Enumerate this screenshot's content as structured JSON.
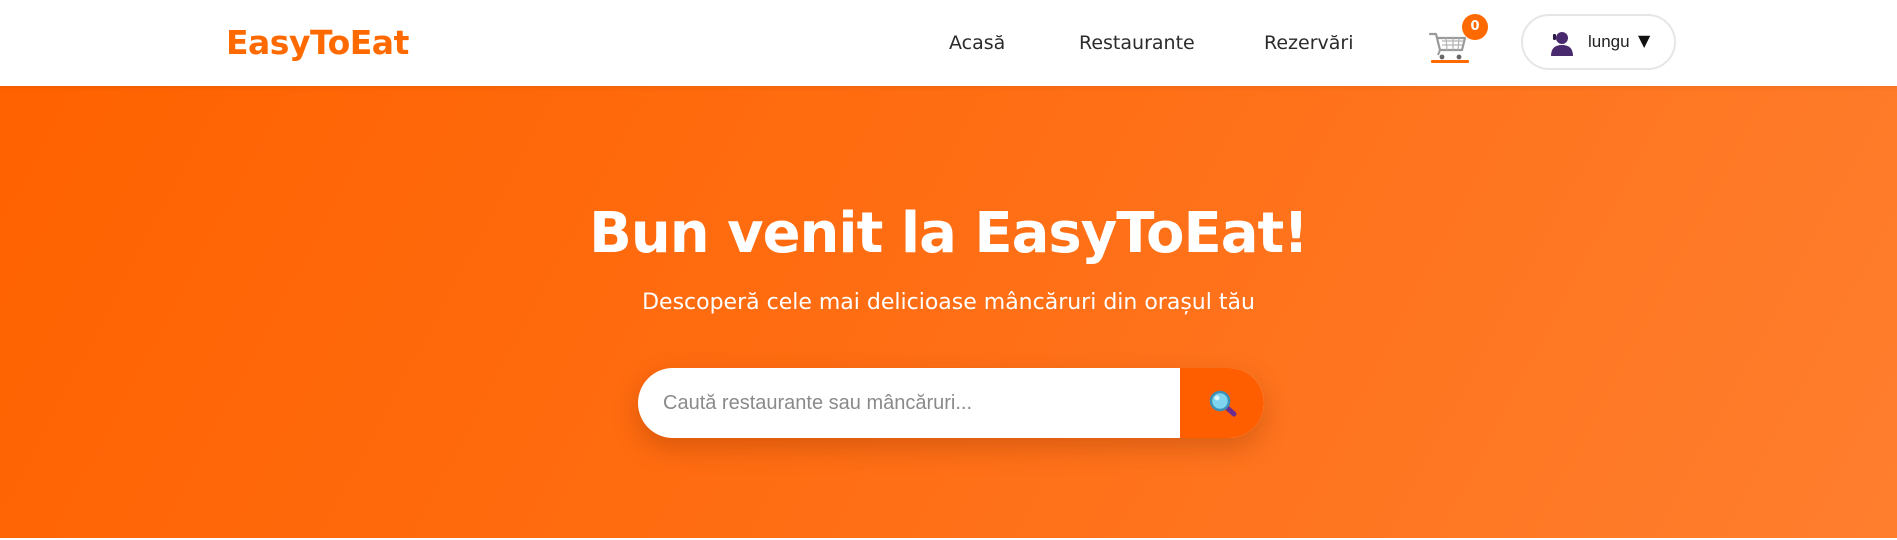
{
  "brand": {
    "logo_text": "EasyToEat",
    "accent_color": "#ff6a00"
  },
  "nav": {
    "links": [
      {
        "label": "Acasă"
      },
      {
        "label": "Restaurante"
      },
      {
        "label": "Rezervări"
      }
    ]
  },
  "cart": {
    "icon": "shopping-cart-icon",
    "count": "0"
  },
  "user": {
    "icon": "user-avatar-icon",
    "username": "lungu",
    "dropdown_caret": "▼"
  },
  "hero": {
    "title": "Bun venit la EasyToEat!",
    "subtitle": "Descoperă cele mai delicioase mâncăruri din orașul tău",
    "gradient_from": "#ff6200",
    "gradient_to": "#ff7e2e"
  },
  "search": {
    "placeholder": "Caută restaurante sau mâncăruri...",
    "value": "",
    "button_icon": "magnifier-icon",
    "button_color": "#ff5e00"
  }
}
